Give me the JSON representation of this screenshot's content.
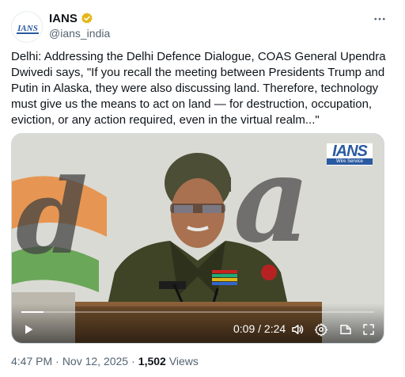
{
  "author": {
    "name": "IANS",
    "handle": "@ians_india",
    "avatar_text": "IANS",
    "verified_color": "#e2b719"
  },
  "more_icon": "more-horizontal-icon",
  "tweet": {
    "text": "Delhi: Addressing the Delhi Defence Dialogue, COAS General Upendra Dwivedi says, \"If you recall the meeting between Presidents Trump and Putin in Alaska, they were also discussing land. Therefore, technology must give us the means to act on land — for destruction, occupation, eviction, or any action required, even in the virtual realm...\""
  },
  "video": {
    "watermark": "IANS",
    "watermark_sub": "Wire Service",
    "current_time": "0:09",
    "separator": " / ",
    "duration": "2:24",
    "progress_fraction": 0.0625,
    "icons": [
      "play-icon",
      "volume-icon",
      "settings-icon",
      "pip-icon",
      "fullscreen-icon"
    ]
  },
  "meta": {
    "time": "4:47 PM",
    "dot1": "·",
    "date": "Nov 12, 2025",
    "dot2": "·",
    "views_count": "1,502",
    "views_label": "Views"
  },
  "colors": {
    "accent": "#1d9bf0",
    "text_primary": "#0f1419",
    "text_secondary": "#536471",
    "ians_blue": "#2a5aa0"
  }
}
